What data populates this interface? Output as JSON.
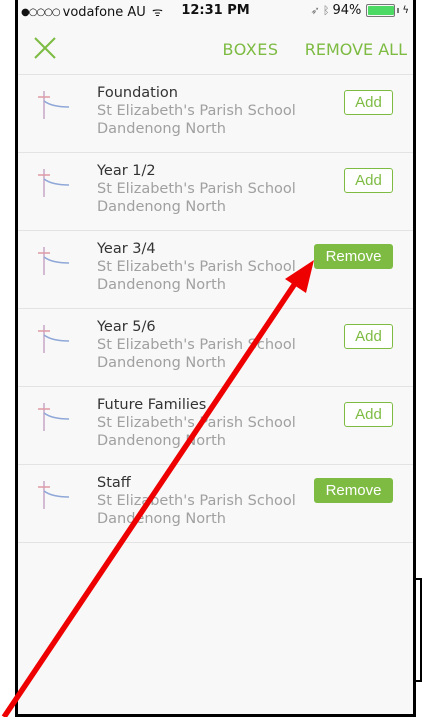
{
  "status_bar": {
    "signal_dots": "●○○○○",
    "carrier": "vodafone AU",
    "wifi_glyph": "ᯤ",
    "time": "12:31 PM",
    "location_glyph": "➶",
    "bluetooth_glyph": "ᛒ",
    "battery_percent": "94%",
    "battery_level": 0.94,
    "charging_glyph": "ϟ"
  },
  "nav": {
    "title": "BOXES",
    "remove_all_label": "REMOVE ALL",
    "close_icon": "close-icon",
    "accent_color": "#7dbb42"
  },
  "list": {
    "items": [
      {
        "title": "Foundation",
        "school": "St Elizabeth's Parish School",
        "suburb": "Dandenong North",
        "action_label": "Add",
        "selected": false
      },
      {
        "title": "Year 1/2",
        "school": "St Elizabeth's Parish School",
        "suburb": "Dandenong North",
        "action_label": "Add",
        "selected": false
      },
      {
        "title": "Year 3/4",
        "school": "St Elizabeth's Parish School",
        "suburb": "Dandenong North",
        "action_label": "Remove",
        "selected": true
      },
      {
        "title": "Year 5/6",
        "school": "St Elizabeth's Parish School",
        "suburb": "Dandenong North",
        "action_label": "Add",
        "selected": false
      },
      {
        "title": "Future Families",
        "school": "St Elizabeth's Parish School",
        "suburb": "Dandenong North",
        "action_label": "Add",
        "selected": false
      },
      {
        "title": "Staff",
        "school": "St Elizabeth's Parish School",
        "suburb": "Dandenong North",
        "action_label": "Remove",
        "selected": true
      }
    ]
  },
  "annotation": {
    "arrow_color": "#ee0000"
  }
}
